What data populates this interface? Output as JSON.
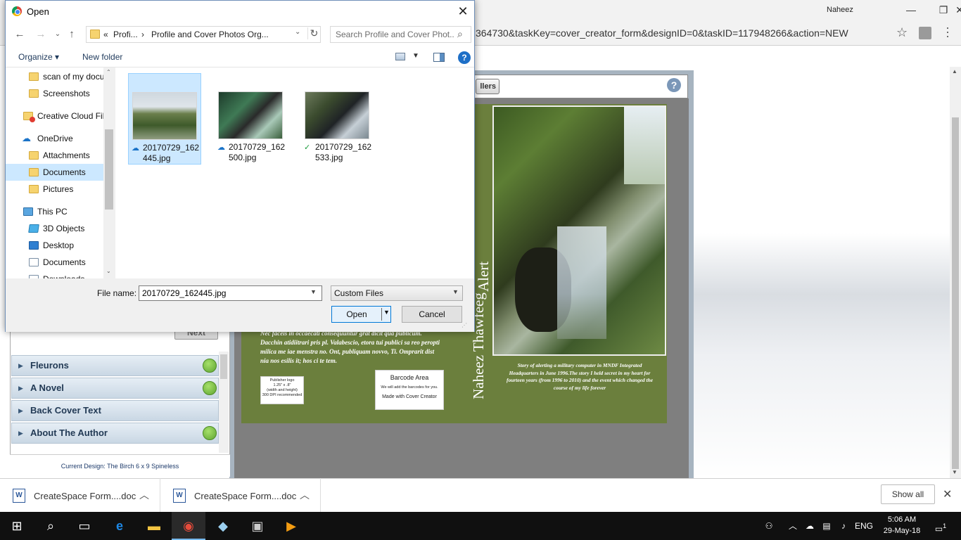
{
  "chrome": {
    "user": "Naheez",
    "min": "—",
    "restore": "❐",
    "close": "✕",
    "url": "364730&taskKey=cover_creator_form&designID=0&taskID=117948266&action=NEW"
  },
  "cover_creator": {
    "fillers_label": "llers",
    "help_label": "?",
    "spine_title": "Alert",
    "spine_author": "Naheez Thawfeeg",
    "front_blurb": "Story of alerting a military computer in MNDF Integrated Headquarters in June 1996.The story I held secret in my heart for fourteen years (from 1996 to 2010) and the event which changed the course of my life forever",
    "back_text": "Nec faceis in occaecati consequuntur grat dicit qua publicum. Dacchin atidiitrari pris pl. Valabescio, etora tui publici sa reo peropti milica me iae menstra no. Ont, publiquam novvo, Ti. Omprarit dist nia nos esilis it; hos ci te tem.",
    "publisher_logo": "Publisher logo\n1.25\" x .8\"\n(width and height)\n300 DPI recommended",
    "barcode_title": "Barcode Area",
    "barcode_sub": "We will add the barcodes for you.",
    "barcode_made": "Made with Cover Creator"
  },
  "sidebar": {
    "next_label": "Next",
    "items": [
      {
        "label": "Fleurons",
        "done": true
      },
      {
        "label": "A Novel",
        "done": true
      },
      {
        "label": "Back Cover Text",
        "done": false
      },
      {
        "label": "About The Author",
        "done": true
      }
    ],
    "current_design": "Current Design: The Birch 6 x 9 Spineless"
  },
  "downloads": {
    "items": [
      {
        "name": "CreateSpace Form....doc"
      },
      {
        "name": "CreateSpace Form....doc"
      }
    ],
    "show_all": "Show all",
    "close": "✕"
  },
  "taskbar": {
    "lang": "ENG",
    "time": "5:06 AM",
    "date": "29-May-18",
    "notifications": "1"
  },
  "dialog": {
    "title": "Open",
    "close": "✕",
    "address": {
      "prefix": "«",
      "crumb1": "Profi...",
      "sep": "›",
      "crumb2": "Profile and Cover Photos Org..."
    },
    "search_placeholder": "Search Profile and Cover Phot...",
    "organize": "Organize ▾",
    "new_folder": "New folder",
    "nav_items": [
      {
        "label": "scan of my docu",
        "icon": "folder"
      },
      {
        "label": "Screenshots",
        "icon": "folder"
      },
      {
        "label": "Creative Cloud Fil",
        "icon": "creative-cloud"
      },
      {
        "label": "OneDrive",
        "icon": "onedrive"
      },
      {
        "label": "Attachments",
        "icon": "folder"
      },
      {
        "label": "Documents",
        "icon": "folder",
        "selected": true
      },
      {
        "label": "Pictures",
        "icon": "folder"
      },
      {
        "label": "This PC",
        "icon": "this-pc"
      },
      {
        "label": "3D Objects",
        "icon": "3d-objects"
      },
      {
        "label": "Desktop",
        "icon": "desktop"
      },
      {
        "label": "Documents",
        "icon": "documents"
      },
      {
        "label": "Downloads",
        "icon": "downloads"
      }
    ],
    "files": [
      {
        "name": "20170729_162445.jpg",
        "status": "cloud",
        "selected": true
      },
      {
        "name": "20170729_162500.jpg",
        "status": "cloud",
        "selected": false
      },
      {
        "name": "20170729_162533.jpg",
        "status": "synced",
        "selected": false
      }
    ],
    "file_name_label": "File name:",
    "file_name_value": "20170729_162445.jpg",
    "filter": "Custom Files",
    "open_label": "Open",
    "cancel_label": "Cancel"
  }
}
